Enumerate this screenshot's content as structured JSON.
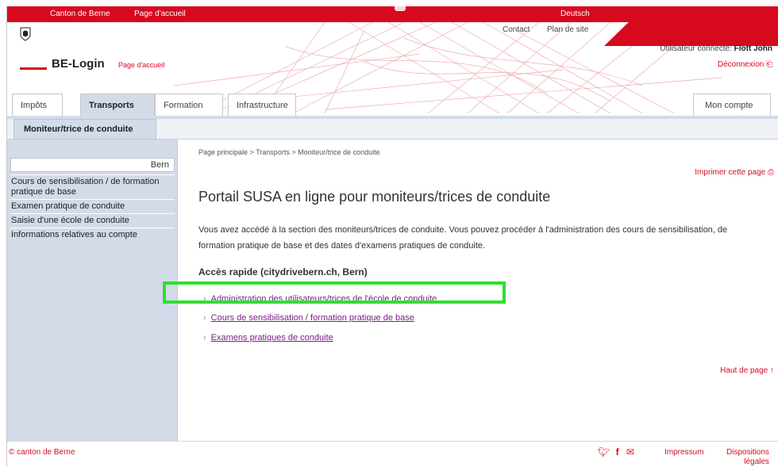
{
  "colors": {
    "brand_red": "#d7091e",
    "nav_blue": "#d3dbe8",
    "visited_link": "#7a1f86",
    "highlight_green": "#2ee02e"
  },
  "topbar": {
    "canton": "Canton de Berne",
    "home": "Page d'accueil",
    "language": "Deutsch"
  },
  "header": {
    "brand": "BE-Login",
    "brand_home": "Page d'accueil",
    "contact": "Contact",
    "sitemap": "Plan de site",
    "user_label": "Utilisateur connecté:",
    "user_name": "Flott John",
    "logout": "Déconnexion"
  },
  "tabs": [
    {
      "label": "Impôts"
    },
    {
      "label": "Transports"
    },
    {
      "label": "Formation"
    },
    {
      "label": "Infrastructure"
    },
    {
      "label": "Mon compte"
    }
  ],
  "subtab": "Moniteur/trice de conduite",
  "sidebar": {
    "search_value": "Bern",
    "items": [
      "Cours de sensibilisation / de formation pratique de base",
      "Examen pratique de conduite",
      "Saisie d'une école de conduite",
      "Informations relatives au compte"
    ]
  },
  "main": {
    "breadcrumb": "Page principale > Transports > Moniteur/trice de conduite",
    "print": "Imprimer cette page",
    "title": "Portail SUSA en ligne pour moniteurs/trices de conduite",
    "intro": "Vous avez accédé à la section des moniteurs/trices de conduite. Vous pouvez procéder à l'administration des cours de sensibilisation, de formation pratique de base et des dates d'examens pratiques de conduite.",
    "quick_title": "Accès rapide (citydrivebern.ch, Bern)",
    "quick_links": [
      "Administration des utilisateurs/trices de l'école de conduite",
      "Cours de sensibilisation / formation pratique de base",
      "Examens pratiques de conduite"
    ],
    "to_top": "Haut de page"
  },
  "footer": {
    "copyright": "© canton de Berne",
    "impressum": "Impressum",
    "legal_line1": "Dispositions",
    "legal_line2": "légales",
    "icons": [
      "twitter-icon",
      "facebook-icon",
      "mail-icon"
    ]
  }
}
